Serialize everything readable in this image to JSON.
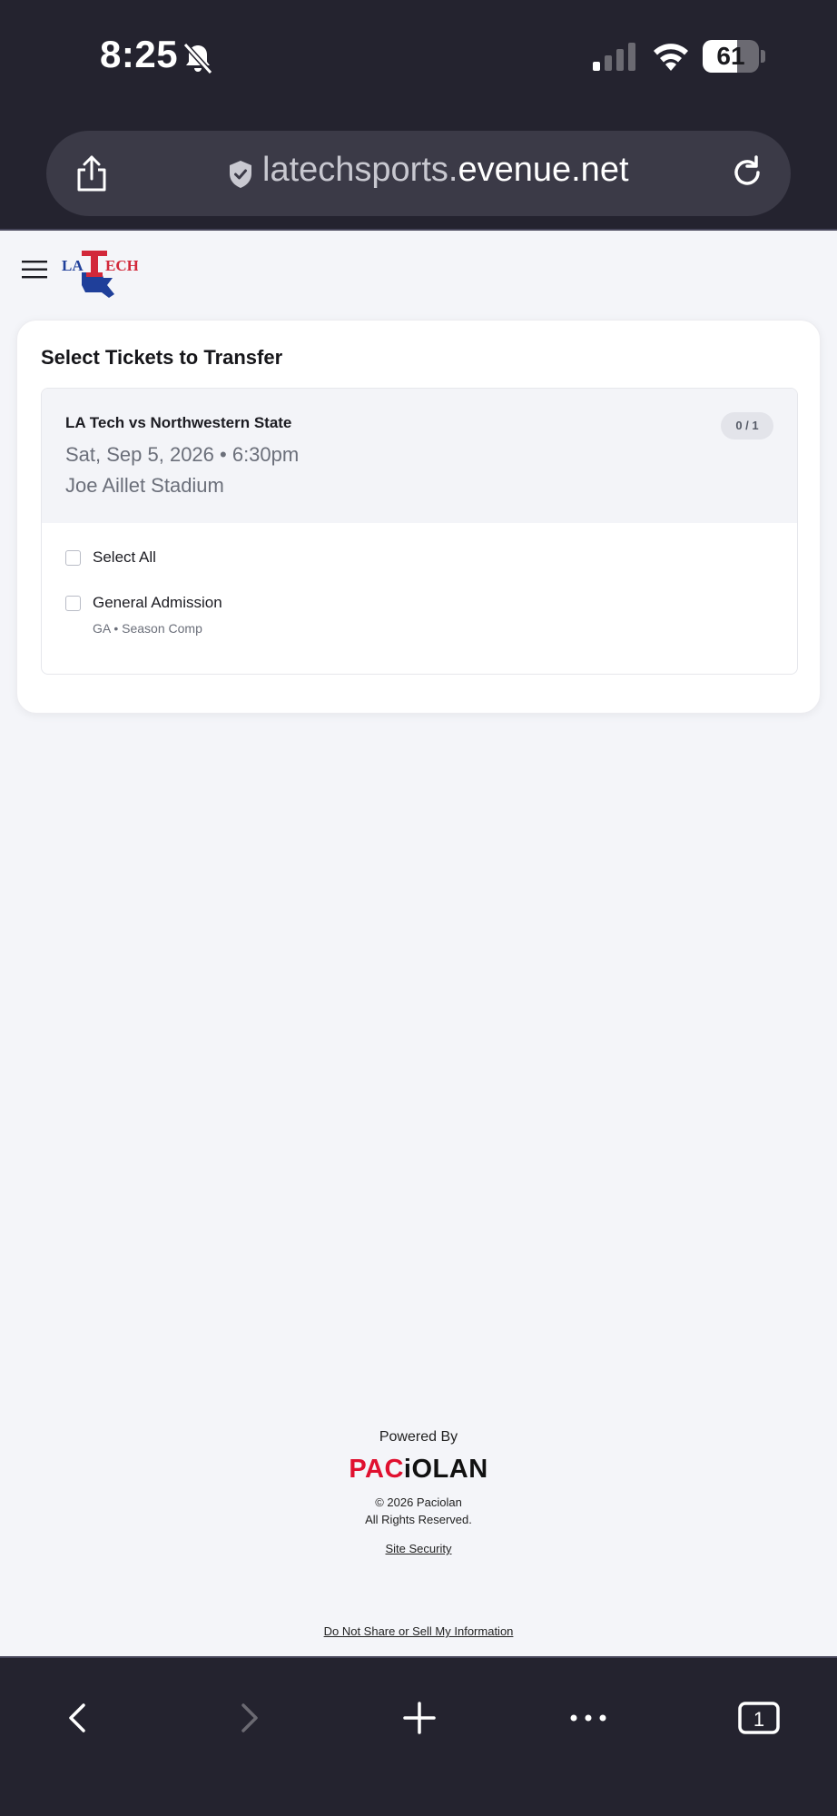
{
  "status_bar": {
    "time": "8:25",
    "battery_level": "61",
    "battery_fraction": 0.61,
    "icons": [
      "bell-slash-icon",
      "cellular-signal-icon",
      "wifi-icon",
      "battery-icon"
    ]
  },
  "browser": {
    "url_subdomain": "latechsports.",
    "url_domain": "evenue.net",
    "icons": [
      "share-icon",
      "shield-icon",
      "reload-icon"
    ]
  },
  "header": {
    "logo_text_left": "LA",
    "logo_text_right": "ECH",
    "icons": [
      "menu-icon"
    ]
  },
  "card": {
    "title": "Select Tickets to Transfer",
    "event": {
      "name": "LA Tech vs Northwestern State",
      "date": "Sat, Sep 5, 2026 • 6:30pm",
      "venue": "Joe Aillet Stadium",
      "count": "0 / 1"
    },
    "select_all_label": "Select All",
    "tickets": [
      {
        "label": "General Admission",
        "sub": "GA • Season Comp"
      }
    ]
  },
  "footer": {
    "powered_by": "Powered By",
    "brand_part1": "PAC",
    "brand_part2": "iOLAN",
    "copyright_line1": "© 2026 Paciolan",
    "copyright_line2": "All Rights Reserved.",
    "site_security": "Site Security",
    "do_not_share": "Do Not Share or Sell My Information"
  },
  "toolbar": {
    "tab_count": "1",
    "icons": [
      "back-icon",
      "forward-icon",
      "new-tab-icon",
      "more-icon",
      "tabs-icon"
    ]
  },
  "colors": {
    "chrome_bg": "#24232f",
    "url_pill": "#3b3a47",
    "page_bg": "#f4f5f9",
    "brand_red": "#e0102f",
    "latech_blue": "#1f3f9a",
    "latech_red": "#d2283a"
  }
}
